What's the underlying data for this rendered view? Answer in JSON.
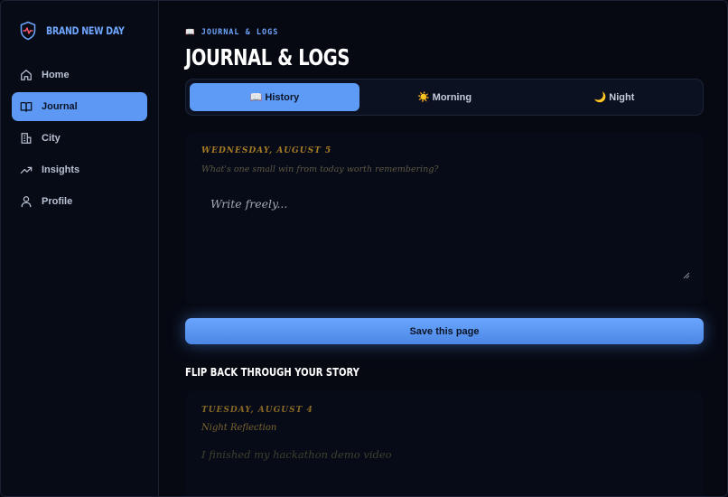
{
  "app": {
    "brand_name": "BRAND NEW DAY",
    "brand_icon": "heartbeat-shield-icon",
    "accent_color": "#5e9bf6"
  },
  "sidebar": {
    "items": [
      {
        "label": "Home",
        "icon": "home-icon",
        "active": false
      },
      {
        "label": "Journal",
        "icon": "book-icon",
        "active": true
      },
      {
        "label": "City",
        "icon": "city-icon",
        "active": false
      },
      {
        "label": "Insights",
        "icon": "trend-icon",
        "active": false
      },
      {
        "label": "Profile",
        "icon": "user-icon",
        "active": false
      }
    ]
  },
  "header": {
    "eyebrow_emoji": "📖",
    "eyebrow": "JOURNAL & LOGS",
    "title": "JOURNAL & LOGS"
  },
  "tabs": [
    {
      "emoji": "📖",
      "label": "History",
      "active": true
    },
    {
      "emoji": "☀️",
      "label": "Morning",
      "active": false
    },
    {
      "emoji": "🌙",
      "label": "Night",
      "active": false
    }
  ],
  "entry": {
    "date": "WEDNESDAY, AUGUST 5",
    "prompt": "What's one small win from today worth remembering?",
    "placeholder": "Write freely...",
    "save_label": "Save this page"
  },
  "history": {
    "title": "FLIP BACK THROUGH YOUR STORY",
    "entries": [
      {
        "date": "TUESDAY, AUGUST 4",
        "kind": "Night Reflection",
        "text": "I finished my hackathon demo video"
      }
    ]
  }
}
